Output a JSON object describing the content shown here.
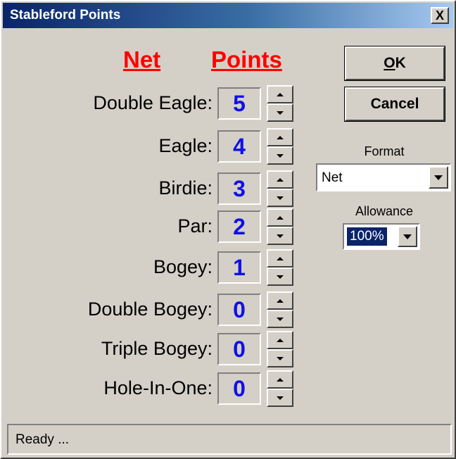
{
  "window": {
    "title": "Stableford Points",
    "close_label": "X"
  },
  "headers": {
    "net": "Net",
    "points": "Points"
  },
  "rows": [
    {
      "label": "Double Eagle:",
      "points": "5"
    },
    {
      "label": "Eagle:",
      "points": "4"
    },
    {
      "label": "Birdie:",
      "points": "3"
    },
    {
      "label": "Par:",
      "points": "2"
    },
    {
      "label": "Bogey:",
      "points": "1"
    },
    {
      "label": "Double Bogey:",
      "points": "0"
    },
    {
      "label": "Triple Bogey:",
      "points": "0"
    },
    {
      "label": "Hole-In-One:",
      "points": "0"
    }
  ],
  "buttons": {
    "ok_label": "OK",
    "ok_mnemonic": "O",
    "ok_rest": "K",
    "cancel_label": "Cancel"
  },
  "format": {
    "label": "Format",
    "value": "Net"
  },
  "allowance": {
    "label": "Allowance",
    "value": "100%"
  },
  "status": {
    "text": "Ready ..."
  },
  "colors": {
    "points_text": "#1010e8",
    "header_text": "#ff0000",
    "titlebar": "#0a246a"
  }
}
